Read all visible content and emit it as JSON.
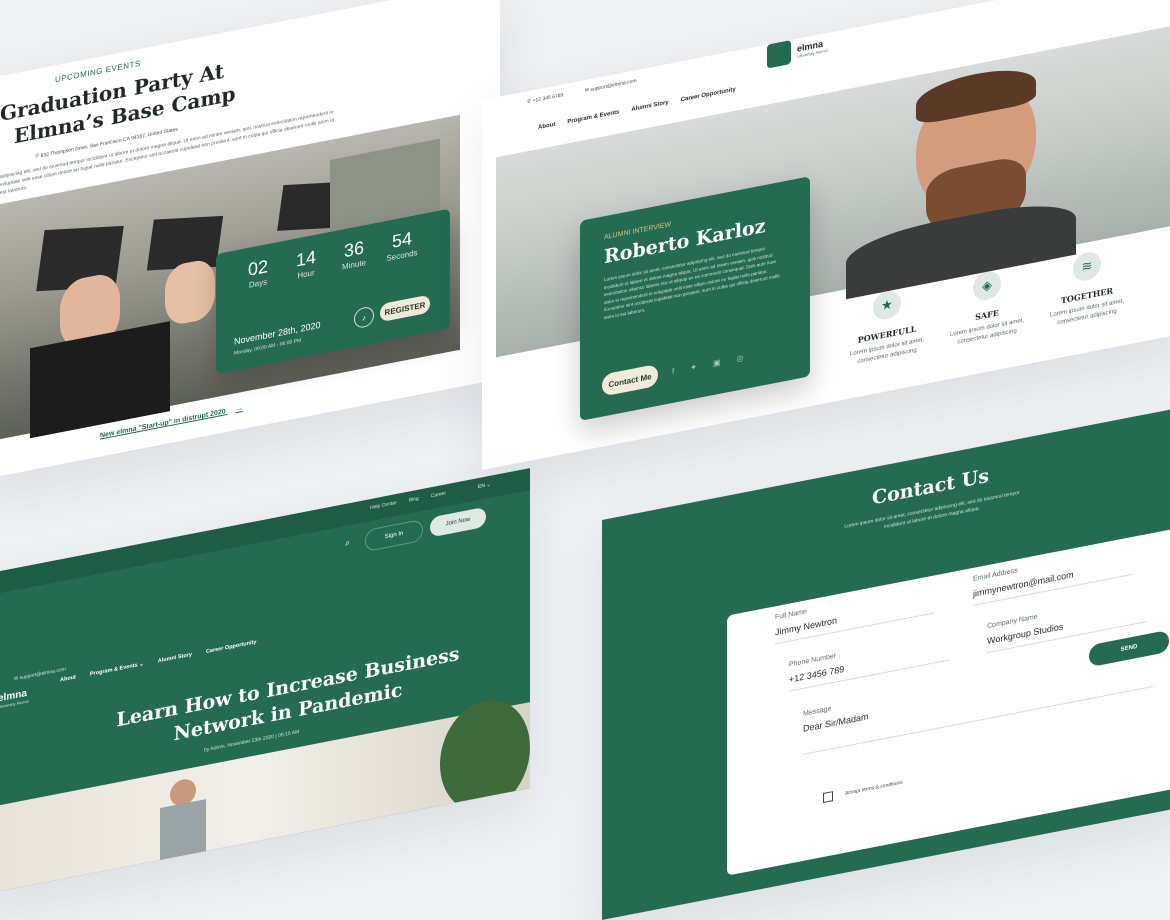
{
  "event_panel": {
    "eyebrow": "UPCOMING EVENTS",
    "title_line1": "Graduation Party At",
    "title_line2": "Elmna’s Base Camp",
    "address": "832 Thompson Drive, San Francisco CA 94107, United States",
    "body": "adipiscing elit, sed do eiusmod tempor incididunt ut labore et dolore magna aliqua. Ut enim ad minim veniam, quis nostrud exercitation reprehenderit in voluptate velit esse cillum dolore eu fugiat nulla pariatur. Excepteur sint occaecat cupidatat non proident, sunt in culpa qui officia deserunt mollit anim id est laborum.",
    "countdown": [
      {
        "value": "02",
        "unit": "Days"
      },
      {
        "value": "14",
        "unit": "Hour"
      },
      {
        "value": "36",
        "unit": "Minute"
      },
      {
        "value": "54",
        "unit": "Seconds"
      }
    ],
    "date": "November 28th, 2020",
    "time": "Monday, 09:00 AM - 06:00 PM",
    "register": "REGISTER",
    "link": "New elmna \"Start-up\" in distrupt 2020"
  },
  "alumni_panel": {
    "phone": "+12 345 6789",
    "email": "support@elmna.com",
    "brand": "elmna",
    "brand_sub": "University Alumni",
    "nav": [
      "About",
      "Program & Events",
      "Alumni Story",
      "Career Opportunity"
    ],
    "eyebrow": "ALUMNI INTERVIEW",
    "name": "Roberto Karloz",
    "body": "Lorem ipsum dolor sit amet, consectetur adipiscing elit, sed do eiusmod tempor incididunt ut labore et dolore magna aliqua. Ut enim ad minim veniam, quis nostrud exercitation ullamco laboris nisi ut aliquip ex ea commodo consequat. Duis aute irure dolor in reprehenderit in voluptate velit esse cillum dolore eu fugiat nulla pariatur. Excepteur sint occaecat cupidatat non proident, sunt in culpa qui officia deserunt mollit anim id est laborum.",
    "contact_btn": "Contact Me",
    "features": [
      {
        "title": "POWERFULL",
        "text": "Lorem ipsum dolor sit amet, consectetur adipiscing",
        "icon": "star-icon"
      },
      {
        "title": "SAFE",
        "text": "Lorem ipsum dolor sit amet, consectetur adipiscing",
        "icon": "shield-icon"
      },
      {
        "title": "TOGETHER",
        "text": "Lorem ipsum dolor sit amet, consectetur adipiscing",
        "icon": "layers-icon"
      }
    ]
  },
  "blog_panel": {
    "top_links": [
      "Help Center",
      "Blog",
      "Career"
    ],
    "lang": "EN",
    "sign_in": "Sign In",
    "join_now": "Join Now",
    "email": "support@elmna.com",
    "brand": "elmna",
    "brand_sub": "University Alumni",
    "nav": [
      "About",
      "Program & Events",
      "Alumni Story",
      "Career Opportunity"
    ],
    "title_line1": "Learn How to Increase Business",
    "title_line2": "Network in Pandemic",
    "meta": "by Admin, November 23th 2020  |  05:15 AM"
  },
  "contact_panel": {
    "title": "Contact Us",
    "subtitle": "Lorem ipsum dolor sit amet, consectetur adipiscing elit, sed do eiusmod tempor incididunt ut labore et dolore magna aliqua.",
    "fields": {
      "full_name": {
        "label": "Full Name",
        "value": "Jimmy Newtron"
      },
      "email": {
        "label": "Email Address",
        "value": "jimmynewtron@mail.com"
      },
      "phone": {
        "label": "Phone Number",
        "value": "+12 3456 789"
      },
      "company": {
        "label": "Company Name",
        "value": "Workgroup Studios"
      },
      "message": {
        "label": "Message",
        "value": "Dear Sir/Madam"
      }
    },
    "send": "SEND",
    "terms": "Accept terms & conditions"
  },
  "colors": {
    "brand_green": "#256b52",
    "cream": "#f2ead9",
    "background": "#eef0f4"
  }
}
